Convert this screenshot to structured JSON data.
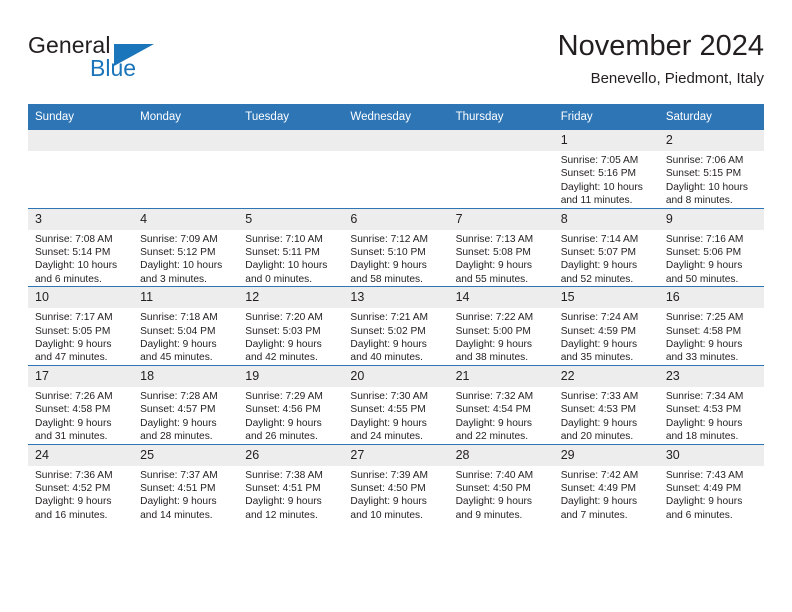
{
  "brand": {
    "name_part1": "General",
    "name_part2": "Blue",
    "logo_icon": "triangle-logo-icon",
    "accent_color": "#1b75bb"
  },
  "header": {
    "title": "November 2024",
    "subtitle": "Benevello, Piedmont, Italy"
  },
  "theme": {
    "header_row_color": "#2e75b6",
    "daynum_band_color": "#ededed",
    "text_color": "#231f20"
  },
  "calendar": {
    "weekday_headers": [
      "Sunday",
      "Monday",
      "Tuesday",
      "Wednesday",
      "Thursday",
      "Friday",
      "Saturday"
    ],
    "weeks": [
      [
        {
          "day": "",
          "blank": true,
          "sunrise": "",
          "sunset": "",
          "daylight1": "",
          "daylight2": ""
        },
        {
          "day": "",
          "blank": true,
          "sunrise": "",
          "sunset": "",
          "daylight1": "",
          "daylight2": ""
        },
        {
          "day": "",
          "blank": true,
          "sunrise": "",
          "sunset": "",
          "daylight1": "",
          "daylight2": ""
        },
        {
          "day": "",
          "blank": true,
          "sunrise": "",
          "sunset": "",
          "daylight1": "",
          "daylight2": ""
        },
        {
          "day": "",
          "blank": true,
          "sunrise": "",
          "sunset": "",
          "daylight1": "",
          "daylight2": ""
        },
        {
          "day": "1",
          "blank": false,
          "sunrise": "Sunrise: 7:05 AM",
          "sunset": "Sunset: 5:16 PM",
          "daylight1": "Daylight: 10 hours",
          "daylight2": "and 11 minutes."
        },
        {
          "day": "2",
          "blank": false,
          "sunrise": "Sunrise: 7:06 AM",
          "sunset": "Sunset: 5:15 PM",
          "daylight1": "Daylight: 10 hours",
          "daylight2": "and 8 minutes."
        }
      ],
      [
        {
          "day": "3",
          "blank": false,
          "sunrise": "Sunrise: 7:08 AM",
          "sunset": "Sunset: 5:14 PM",
          "daylight1": "Daylight: 10 hours",
          "daylight2": "and 6 minutes."
        },
        {
          "day": "4",
          "blank": false,
          "sunrise": "Sunrise: 7:09 AM",
          "sunset": "Sunset: 5:12 PM",
          "daylight1": "Daylight: 10 hours",
          "daylight2": "and 3 minutes."
        },
        {
          "day": "5",
          "blank": false,
          "sunrise": "Sunrise: 7:10 AM",
          "sunset": "Sunset: 5:11 PM",
          "daylight1": "Daylight: 10 hours",
          "daylight2": "and 0 minutes."
        },
        {
          "day": "6",
          "blank": false,
          "sunrise": "Sunrise: 7:12 AM",
          "sunset": "Sunset: 5:10 PM",
          "daylight1": "Daylight: 9 hours",
          "daylight2": "and 58 minutes."
        },
        {
          "day": "7",
          "blank": false,
          "sunrise": "Sunrise: 7:13 AM",
          "sunset": "Sunset: 5:08 PM",
          "daylight1": "Daylight: 9 hours",
          "daylight2": "and 55 minutes."
        },
        {
          "day": "8",
          "blank": false,
          "sunrise": "Sunrise: 7:14 AM",
          "sunset": "Sunset: 5:07 PM",
          "daylight1": "Daylight: 9 hours",
          "daylight2": "and 52 minutes."
        },
        {
          "day": "9",
          "blank": false,
          "sunrise": "Sunrise: 7:16 AM",
          "sunset": "Sunset: 5:06 PM",
          "daylight1": "Daylight: 9 hours",
          "daylight2": "and 50 minutes."
        }
      ],
      [
        {
          "day": "10",
          "blank": false,
          "sunrise": "Sunrise: 7:17 AM",
          "sunset": "Sunset: 5:05 PM",
          "daylight1": "Daylight: 9 hours",
          "daylight2": "and 47 minutes."
        },
        {
          "day": "11",
          "blank": false,
          "sunrise": "Sunrise: 7:18 AM",
          "sunset": "Sunset: 5:04 PM",
          "daylight1": "Daylight: 9 hours",
          "daylight2": "and 45 minutes."
        },
        {
          "day": "12",
          "blank": false,
          "sunrise": "Sunrise: 7:20 AM",
          "sunset": "Sunset: 5:03 PM",
          "daylight1": "Daylight: 9 hours",
          "daylight2": "and 42 minutes."
        },
        {
          "day": "13",
          "blank": false,
          "sunrise": "Sunrise: 7:21 AM",
          "sunset": "Sunset: 5:02 PM",
          "daylight1": "Daylight: 9 hours",
          "daylight2": "and 40 minutes."
        },
        {
          "day": "14",
          "blank": false,
          "sunrise": "Sunrise: 7:22 AM",
          "sunset": "Sunset: 5:00 PM",
          "daylight1": "Daylight: 9 hours",
          "daylight2": "and 38 minutes."
        },
        {
          "day": "15",
          "blank": false,
          "sunrise": "Sunrise: 7:24 AM",
          "sunset": "Sunset: 4:59 PM",
          "daylight1": "Daylight: 9 hours",
          "daylight2": "and 35 minutes."
        },
        {
          "day": "16",
          "blank": false,
          "sunrise": "Sunrise: 7:25 AM",
          "sunset": "Sunset: 4:58 PM",
          "daylight1": "Daylight: 9 hours",
          "daylight2": "and 33 minutes."
        }
      ],
      [
        {
          "day": "17",
          "blank": false,
          "sunrise": "Sunrise: 7:26 AM",
          "sunset": "Sunset: 4:58 PM",
          "daylight1": "Daylight: 9 hours",
          "daylight2": "and 31 minutes."
        },
        {
          "day": "18",
          "blank": false,
          "sunrise": "Sunrise: 7:28 AM",
          "sunset": "Sunset: 4:57 PM",
          "daylight1": "Daylight: 9 hours",
          "daylight2": "and 28 minutes."
        },
        {
          "day": "19",
          "blank": false,
          "sunrise": "Sunrise: 7:29 AM",
          "sunset": "Sunset: 4:56 PM",
          "daylight1": "Daylight: 9 hours",
          "daylight2": "and 26 minutes."
        },
        {
          "day": "20",
          "blank": false,
          "sunrise": "Sunrise: 7:30 AM",
          "sunset": "Sunset: 4:55 PM",
          "daylight1": "Daylight: 9 hours",
          "daylight2": "and 24 minutes."
        },
        {
          "day": "21",
          "blank": false,
          "sunrise": "Sunrise: 7:32 AM",
          "sunset": "Sunset: 4:54 PM",
          "daylight1": "Daylight: 9 hours",
          "daylight2": "and 22 minutes."
        },
        {
          "day": "22",
          "blank": false,
          "sunrise": "Sunrise: 7:33 AM",
          "sunset": "Sunset: 4:53 PM",
          "daylight1": "Daylight: 9 hours",
          "daylight2": "and 20 minutes."
        },
        {
          "day": "23",
          "blank": false,
          "sunrise": "Sunrise: 7:34 AM",
          "sunset": "Sunset: 4:53 PM",
          "daylight1": "Daylight: 9 hours",
          "daylight2": "and 18 minutes."
        }
      ],
      [
        {
          "day": "24",
          "blank": false,
          "sunrise": "Sunrise: 7:36 AM",
          "sunset": "Sunset: 4:52 PM",
          "daylight1": "Daylight: 9 hours",
          "daylight2": "and 16 minutes."
        },
        {
          "day": "25",
          "blank": false,
          "sunrise": "Sunrise: 7:37 AM",
          "sunset": "Sunset: 4:51 PM",
          "daylight1": "Daylight: 9 hours",
          "daylight2": "and 14 minutes."
        },
        {
          "day": "26",
          "blank": false,
          "sunrise": "Sunrise: 7:38 AM",
          "sunset": "Sunset: 4:51 PM",
          "daylight1": "Daylight: 9 hours",
          "daylight2": "and 12 minutes."
        },
        {
          "day": "27",
          "blank": false,
          "sunrise": "Sunrise: 7:39 AM",
          "sunset": "Sunset: 4:50 PM",
          "daylight1": "Daylight: 9 hours",
          "daylight2": "and 10 minutes."
        },
        {
          "day": "28",
          "blank": false,
          "sunrise": "Sunrise: 7:40 AM",
          "sunset": "Sunset: 4:50 PM",
          "daylight1": "Daylight: 9 hours",
          "daylight2": "and 9 minutes."
        },
        {
          "day": "29",
          "blank": false,
          "sunrise": "Sunrise: 7:42 AM",
          "sunset": "Sunset: 4:49 PM",
          "daylight1": "Daylight: 9 hours",
          "daylight2": "and 7 minutes."
        },
        {
          "day": "30",
          "blank": false,
          "sunrise": "Sunrise: 7:43 AM",
          "sunset": "Sunset: 4:49 PM",
          "daylight1": "Daylight: 9 hours",
          "daylight2": "and 6 minutes."
        }
      ]
    ]
  }
}
